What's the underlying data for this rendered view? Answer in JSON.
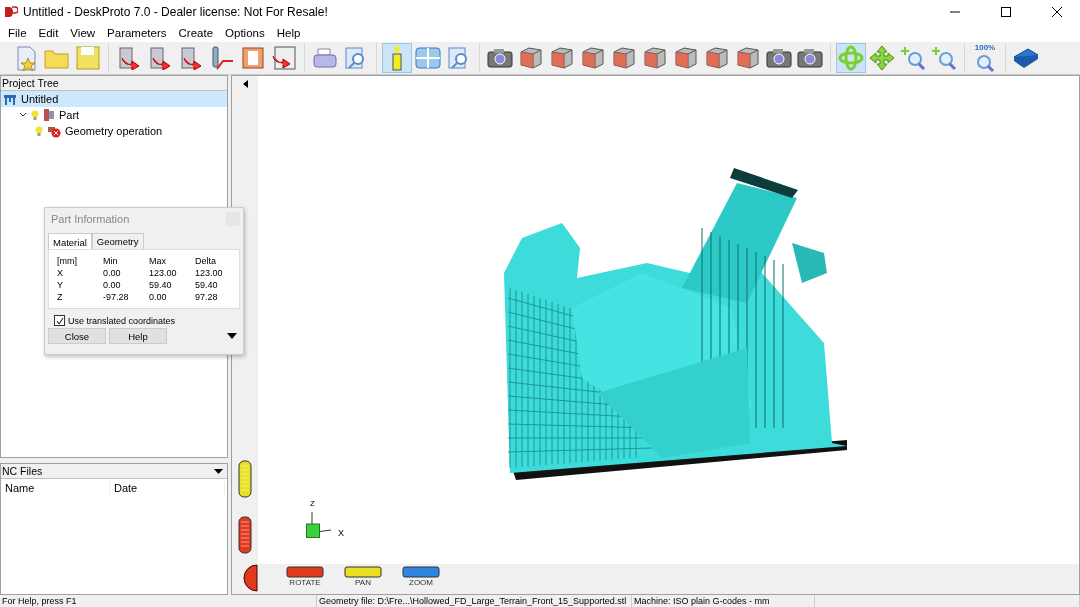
{
  "window": {
    "title": "Untitled - DeskProto 7.0 - Dealer license: Not For Resale!"
  },
  "menu": [
    "File",
    "Edit",
    "View",
    "Parameters",
    "Create",
    "Options",
    "Help"
  ],
  "toolbar": [
    [
      {
        "kind": "new",
        "selected": false
      },
      {
        "kind": "folder",
        "selected": false
      },
      {
        "kind": "disk",
        "selected": false
      }
    ],
    [
      {
        "kind": "import",
        "selected": false
      },
      {
        "kind": "import",
        "selected": false
      },
      {
        "kind": "import",
        "selected": false
      },
      {
        "kind": "tool",
        "selected": false
      },
      {
        "kind": "material",
        "selected": false
      },
      {
        "kind": "export",
        "selected": false
      }
    ],
    [
      {
        "kind": "printer",
        "selected": false
      },
      {
        "kind": "preview",
        "selected": false
      }
    ],
    [
      {
        "kind": "info",
        "selected": true
      },
      {
        "kind": "grid",
        "selected": false
      },
      {
        "kind": "preview",
        "selected": false
      }
    ],
    [
      {
        "kind": "camera",
        "selected": false
      },
      {
        "kind": "cube",
        "selected": false
      },
      {
        "kind": "cube",
        "selected": false
      },
      {
        "kind": "cube",
        "selected": false
      },
      {
        "kind": "cube",
        "selected": false
      },
      {
        "kind": "cube",
        "selected": false
      },
      {
        "kind": "cube",
        "selected": false
      },
      {
        "kind": "cube",
        "selected": false
      },
      {
        "kind": "cube",
        "selected": false
      },
      {
        "kind": "camera",
        "selected": false
      },
      {
        "kind": "camera",
        "selected": false
      }
    ],
    [
      {
        "kind": "rotate",
        "selected": true
      },
      {
        "kind": "move",
        "selected": false
      },
      {
        "kind": "zoom",
        "selected": false
      },
      {
        "kind": "zoom",
        "selected": false
      }
    ],
    [
      {
        "kind": "zoom-all",
        "selected": false,
        "label": "100%"
      }
    ],
    [
      {
        "kind": "book",
        "selected": false
      }
    ]
  ],
  "project_tree": {
    "title": "Project Tree",
    "items": [
      {
        "label": "Untitled",
        "kind": "project",
        "selected": true,
        "children": [
          {
            "label": "Part",
            "kind": "part",
            "selected": false,
            "expanded": true,
            "children": [
              {
                "label": "Geometry operation",
                "kind": "operation",
                "selected": false
              }
            ]
          }
        ]
      }
    ]
  },
  "part_information": {
    "title": "Part Information",
    "tabs": [
      {
        "label": "Material",
        "selected": true
      },
      {
        "label": "Geometry",
        "selected": false
      }
    ],
    "columns": [
      "[mm]",
      "Min",
      "Max",
      "Delta"
    ],
    "rows": [
      [
        "X",
        "0.00",
        "123.00",
        "123.00"
      ],
      [
        "Y",
        "0.00",
        "59.40",
        "59.40"
      ],
      [
        "Z",
        "-97.28",
        "0.00",
        "97.28"
      ]
    ],
    "use_translated_coordinates": {
      "label": "Use translated coordinates",
      "checked": true
    },
    "buttons": [
      "Close",
      "Help"
    ]
  },
  "nc_files": {
    "title": "NC Files",
    "columns": [
      "Name",
      "Date"
    ]
  },
  "viewport": {
    "axis_labels": [
      "Z",
      "X"
    ],
    "wheels": [
      {
        "label": "ROTATE",
        "color": "#e03a1e"
      },
      {
        "label": "PAN",
        "color": "#e8e020"
      },
      {
        "label": "ZOOM",
        "color": "#2f86e0"
      }
    ]
  },
  "status_bar": [
    "For Help, press F1",
    "Geometry file: D:\\Fre...\\Hollowed_FD_Large_Terrain_Front_15_Supported.stl",
    "Machine: ISO plain G-codes - mm"
  ]
}
